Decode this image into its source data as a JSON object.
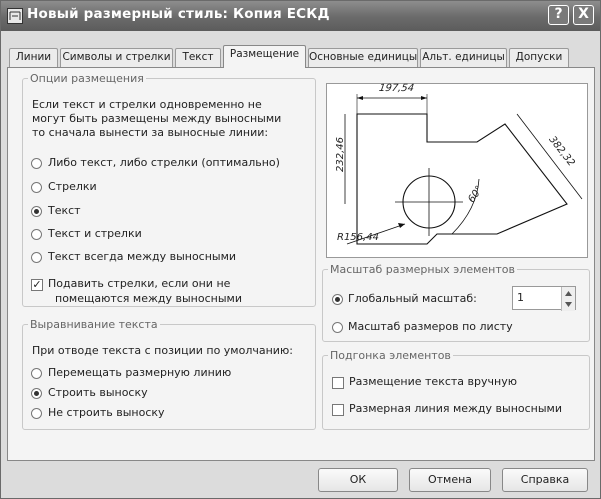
{
  "window": {
    "title": "Новый размерный стиль: Копия ЕСКД",
    "help_label": "?",
    "close_label": "X"
  },
  "tabs": [
    {
      "label": "Линии"
    },
    {
      "label": "Символы и стрелки"
    },
    {
      "label": "Текст"
    },
    {
      "label": "Размещение",
      "active": true
    },
    {
      "label": "Основные единицы"
    },
    {
      "label": "Альт. единицы"
    },
    {
      "label": "Допуски"
    }
  ],
  "fit_options": {
    "legend": "Опции размещения",
    "description": [
      "Если текст и стрелки одновременно не",
      "могут быть размещены между выносными",
      "то сначала вынести за выносные линии:"
    ],
    "options": [
      {
        "label": "Либо текст, либо стрелки (оптимально)",
        "selected": false
      },
      {
        "label": "Стрелки",
        "selected": false
      },
      {
        "label": "Текст",
        "selected": true
      },
      {
        "label": "Текст и стрелки",
        "selected": false
      },
      {
        "label": "Текст всегда между выносными",
        "selected": false
      }
    ],
    "suppress_arrows": {
      "label_line1": "Подавить стрелки, если они не",
      "label_line2": "помещаются между выносными",
      "checked": true
    }
  },
  "text_placement": {
    "legend": "Выравнивание текста",
    "description": "При отводе текста с позиции по умолчанию:",
    "options": [
      {
        "label": "Перемещать размерную линию",
        "selected": false
      },
      {
        "label": "Строить выноску",
        "selected": true
      },
      {
        "label": "Не строить выноску",
        "selected": false
      }
    ]
  },
  "preview": {
    "dim_top": "197,54",
    "dim_left": "232,46",
    "dim_right": "382,32",
    "dim_angle": "60°",
    "dim_radius": "R156,44"
  },
  "scale": {
    "legend": "Масштаб размерных элементов",
    "options": [
      {
        "label": "Глобальный масштаб:",
        "selected": true
      },
      {
        "label": "Масштаб размеров по листу",
        "selected": false
      }
    ],
    "value": "1"
  },
  "fine_tuning": {
    "legend": "Подгонка элементов",
    "options": [
      {
        "label": "Размещение текста вручную",
        "checked": false
      },
      {
        "label": "Размерная линия между выносными",
        "checked": false
      }
    ]
  },
  "buttons": {
    "ok": "ОК",
    "cancel": "Отмена",
    "help": "Справка"
  }
}
